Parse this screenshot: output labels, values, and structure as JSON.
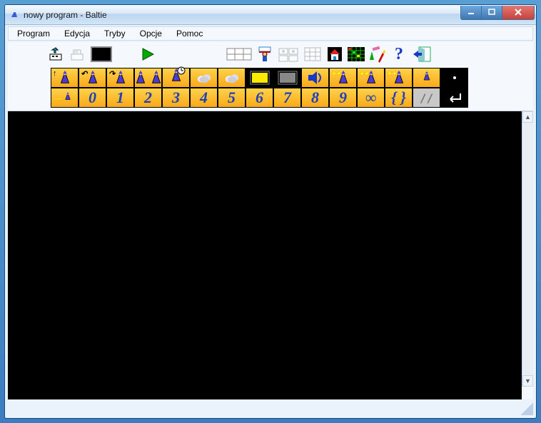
{
  "title": "nowy program - Baltie",
  "menu": {
    "program": "Program",
    "edycja": "Edycja",
    "tryby": "Tryby",
    "opcje": "Opcje",
    "pomoc": "Pomoc"
  },
  "toolbar": {
    "open_icon": "open",
    "print_icon": "print",
    "screen_icon": "screen",
    "run_icon": "run",
    "tiles_icon": "tiles",
    "props_icon": "props",
    "layers_icon": "layers",
    "grid_icon": "grid",
    "house_icon": "house",
    "table_icon": "table",
    "paint_icon": "paint",
    "help_icon": "?",
    "exit_icon": "exit"
  },
  "palette_row1": [
    {
      "name": "wizard-step",
      "type": "wiz",
      "orange": true
    },
    {
      "name": "wizard-turn-left",
      "type": "wiz",
      "orange": true
    },
    {
      "name": "wizard-turn-right",
      "type": "wiz",
      "orange": true
    },
    {
      "name": "wizard-jump",
      "type": "wizpair",
      "orange": true
    },
    {
      "name": "wizard-wait",
      "type": "wizclock",
      "orange": true
    },
    {
      "name": "cloud-1",
      "type": "cloud",
      "orange": true
    },
    {
      "name": "cloud-2",
      "type": "cloud2",
      "orange": true
    },
    {
      "name": "monitor-1",
      "type": "mon",
      "orange": false
    },
    {
      "name": "monitor-2",
      "type": "mon2",
      "orange": false
    },
    {
      "name": "sound",
      "type": "sound",
      "orange": true
    },
    {
      "name": "wizard-sparkle-1",
      "type": "wizspark",
      "orange": true
    },
    {
      "name": "wizard-sparkle-2",
      "type": "wizspark",
      "orange": true
    },
    {
      "name": "wizard-sparkle-3",
      "type": "wizspark",
      "orange": true
    },
    {
      "name": "wizard-small",
      "type": "wizsm",
      "orange": true
    },
    {
      "name": "black-dot",
      "type": "dot",
      "orange": false
    }
  ],
  "palette_row2": [
    {
      "name": "speed",
      "label": "",
      "type": "speed",
      "orange": true
    },
    {
      "name": "num0",
      "label": "0",
      "type": "num",
      "orange": true
    },
    {
      "name": "num1",
      "label": "1",
      "type": "num",
      "orange": true
    },
    {
      "name": "num2",
      "label": "2",
      "type": "num",
      "orange": true
    },
    {
      "name": "num3",
      "label": "3",
      "type": "num",
      "orange": true
    },
    {
      "name": "num4",
      "label": "4",
      "type": "num",
      "orange": true
    },
    {
      "name": "num5",
      "label": "5",
      "type": "num",
      "orange": true
    },
    {
      "name": "num6",
      "label": "6",
      "type": "num",
      "orange": true
    },
    {
      "name": "num7",
      "label": "7",
      "type": "num",
      "orange": true
    },
    {
      "name": "num8",
      "label": "8",
      "type": "num",
      "orange": true
    },
    {
      "name": "num9",
      "label": "9",
      "type": "num",
      "orange": true
    },
    {
      "name": "infinity",
      "label": "∞",
      "type": "num",
      "orange": true
    },
    {
      "name": "braces",
      "label": "{ }",
      "type": "num",
      "orange": true
    },
    {
      "name": "comment",
      "label": "//",
      "type": "plain",
      "orange": false
    },
    {
      "name": "enter",
      "label": "↵",
      "type": "enter",
      "orange": false
    }
  ]
}
